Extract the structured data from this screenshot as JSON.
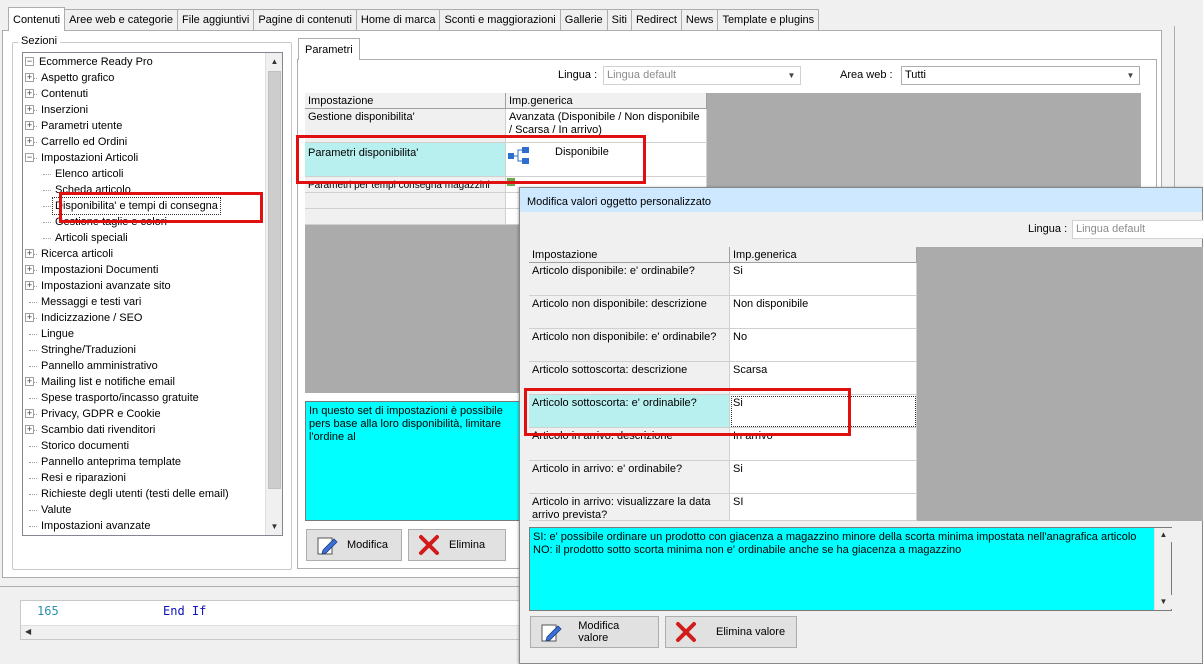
{
  "tabs": [
    "Contenuti",
    "Aree web e categorie",
    "File aggiuntivi",
    "Pagine di contenuti",
    "Home di marca",
    "Sconti e maggiorazioni",
    "Gallerie",
    "Siti",
    "Redirect",
    "News",
    "Template e plugins"
  ],
  "sezioni": {
    "title": "Sezioni",
    "items": [
      {
        "label": "Ecommerce Ready Pro",
        "level": 0,
        "expander": "-"
      },
      {
        "label": "Aspetto grafico",
        "level": 1,
        "expander": "+"
      },
      {
        "label": "Contenuti",
        "level": 1,
        "expander": "+"
      },
      {
        "label": "Inserzioni",
        "level": 1,
        "expander": "+"
      },
      {
        "label": "Parametri utente",
        "level": 1,
        "expander": "+"
      },
      {
        "label": "Carrello ed Ordini",
        "level": 1,
        "expander": "+"
      },
      {
        "label": "Impostazioni Articoli",
        "level": 1,
        "expander": "-"
      },
      {
        "label": "Elenco articoli",
        "level": 2,
        "expander": ""
      },
      {
        "label": "Scheda articolo",
        "level": 2,
        "expander": ""
      },
      {
        "label": "Disponibilita' e tempi di consegna",
        "level": 2,
        "expander": "",
        "selected": true
      },
      {
        "label": "Gestione taglie e colori",
        "level": 2,
        "expander": ""
      },
      {
        "label": "Articoli speciali",
        "level": 2,
        "expander": ""
      },
      {
        "label": "Ricerca articoli",
        "level": 1,
        "expander": "+"
      },
      {
        "label": "Impostazioni Documenti",
        "level": 1,
        "expander": "+"
      },
      {
        "label": "Impostazioni avanzate sito",
        "level": 1,
        "expander": "+"
      },
      {
        "label": "Messaggi e testi vari",
        "level": 1,
        "expander": ""
      },
      {
        "label": "Indicizzazione / SEO",
        "level": 1,
        "expander": "+"
      },
      {
        "label": "Lingue",
        "level": 1,
        "expander": ""
      },
      {
        "label": "Stringhe/Traduzioni",
        "level": 1,
        "expander": ""
      },
      {
        "label": "Pannello amministrativo",
        "level": 1,
        "expander": ""
      },
      {
        "label": "Mailing list e notifiche email",
        "level": 1,
        "expander": "+"
      },
      {
        "label": "Spese trasporto/incasso gratuite",
        "level": 1,
        "expander": ""
      },
      {
        "label": "Privacy, GDPR e Cookie",
        "level": 1,
        "expander": "+"
      },
      {
        "label": "Scambio dati rivenditori",
        "level": 1,
        "expander": "+"
      },
      {
        "label": "Storico documenti",
        "level": 1,
        "expander": ""
      },
      {
        "label": "Pannello anteprima template",
        "level": 1,
        "expander": ""
      },
      {
        "label": "Resi e riparazioni",
        "level": 1,
        "expander": ""
      },
      {
        "label": "Richieste degli utenti (testi delle email)",
        "level": 1,
        "expander": ""
      },
      {
        "label": "Valute",
        "level": 1,
        "expander": ""
      },
      {
        "label": "Impostazioni avanzate",
        "level": 1,
        "expander": ""
      }
    ]
  },
  "parametri": {
    "tab_label": "Parametri",
    "lingua_label": "Lingua :",
    "lingua_value": "Lingua default",
    "area_label": "Area web :",
    "area_value": "Tutti",
    "grid": {
      "headers": [
        "Impostazione",
        "Imp.generica"
      ],
      "rows": [
        [
          "Gestione disponibilita'",
          "Avanzata (Disponibile / Non disponibile / Scarsa / In arrivo)"
        ],
        [
          "Parametri disponibilita'",
          "Disponibile"
        ],
        [
          "Parametri per tempi consegna magazzini",
          ""
        ]
      ]
    },
    "description": "In questo set di impostazioni è possibile pers base alla loro disponibilità, limitare l'ordine al",
    "modifica_label": "Modifica",
    "elimina_label": "Elimina"
  },
  "code": {
    "line_number": "165",
    "text": "End If"
  },
  "dialog": {
    "title": "Modifica valori oggetto personalizzato",
    "lingua_label": "Lingua :",
    "lingua_value": "Lingua default",
    "grid": {
      "headers": [
        "Impostazione",
        "Imp.generica"
      ],
      "rows": [
        [
          "Articolo disponibile: e' ordinabile?",
          "Si"
        ],
        [
          "Articolo non disponibile: descrizione",
          "Non disponibile"
        ],
        [
          "Articolo non disponibile: e' ordinabile?",
          "No"
        ],
        [
          "Articolo sottoscorta: descrizione",
          "Scarsa"
        ],
        [
          "Articolo sottoscorta: e' ordinabile?",
          "Si"
        ],
        [
          "Articolo in arrivo: descrizione",
          "In arrivo"
        ],
        [
          "Articolo in arrivo: e' ordinabile?",
          "Si"
        ],
        [
          "Articolo in arrivo: visualizzare la data arrivo prevista?",
          "SI"
        ]
      ]
    },
    "description_line1": "SI: e' possibile ordinare un prodotto con giacenza a magazzino minore della scorta minima impostata nell'anagrafica articolo",
    "description_line2": "NO: il prodotto sotto scorta minima non e' ordinabile anche se ha giacenza a magazzino",
    "modifica_label": "Modifica valore",
    "elimina_label": "Elimina valore"
  },
  "colors": {
    "highlight": "#e01010",
    "cyan": "#00ffff",
    "selected_row": "#b8f0f0",
    "title_bar": "#cde8ff",
    "code_keyword": "#1010c0"
  }
}
